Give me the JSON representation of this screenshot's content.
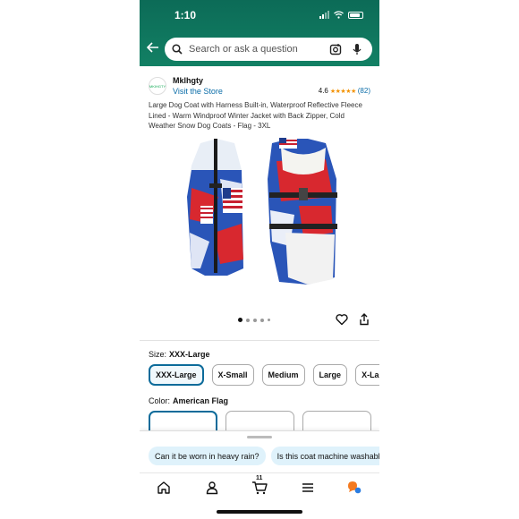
{
  "status": {
    "time": "1:10"
  },
  "search": {
    "placeholder": "Search or ask a question"
  },
  "seller": {
    "logo_text": "MKIHGTY",
    "name": "Mklhgty",
    "link": "Visit the Store",
    "rating": "4.6",
    "stars": "★★★★★",
    "count": "(82)"
  },
  "product": {
    "title": "Large Dog Coat with Harness Built-in, Waterproof Reflective Fleece Lined - Warm Windproof Winter Jacket with Back Zipper, Cold Weather Snow Dog Coats - Flag - 3XL",
    "image_count": 5,
    "active_image": 1
  },
  "size": {
    "label": "Size:",
    "selected": "XXX-Large",
    "options": [
      "XXX-Large",
      "X-Small",
      "Medium",
      "Large",
      "X-Large"
    ]
  },
  "color": {
    "label": "Color:",
    "selected": "American Flag"
  },
  "questions": [
    "Can it be worn in heavy rain?",
    "Is this coat machine washable?"
  ],
  "nav": {
    "cart_count": "11",
    "items": [
      "home-icon",
      "account-icon",
      "cart-icon",
      "menu-icon",
      "rufus-icon"
    ]
  },
  "colors": {
    "header": "#0c6b57",
    "link": "#0b6da8",
    "accent_border": "#0c6b9a",
    "star": "#f39200"
  }
}
